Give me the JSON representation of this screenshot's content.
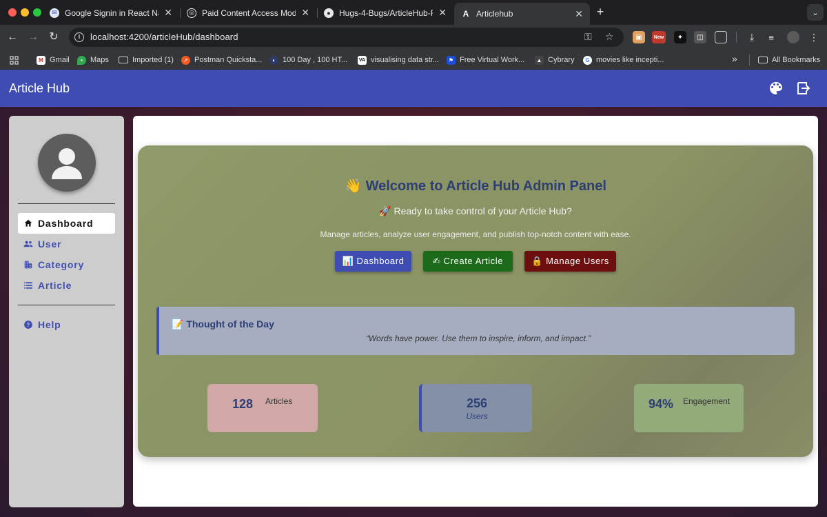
{
  "browser": {
    "tabs": [
      {
        "title": "Google Signin in React Native",
        "favicon": "app-favicon"
      },
      {
        "title": "Paid Content Access Model",
        "favicon": "openai-favicon"
      },
      {
        "title": "Hugs-4-Bugs/ArticleHub-Fro",
        "favicon": "github-favicon"
      },
      {
        "title": "Articlehub",
        "favicon": "angular-favicon",
        "active": true
      }
    ],
    "url": "localhost:4200/articleHub/dashboard",
    "extension_badge": "New",
    "bookmarks": [
      {
        "label": "Gmail",
        "icon": "gmail-icon"
      },
      {
        "label": "Maps",
        "icon": "maps-icon"
      },
      {
        "label": "Imported (1)",
        "icon": "folder-icon"
      },
      {
        "label": "Postman Quicksta...",
        "icon": "postman-icon"
      },
      {
        "label": "100 Day , 100 HT...",
        "icon": "site-icon"
      },
      {
        "label": "visualising data str...",
        "icon": "va-icon"
      },
      {
        "label": "Free Virtual Work...",
        "icon": "site-icon"
      },
      {
        "label": "Cybrary",
        "icon": "cybrary-icon"
      },
      {
        "label": "movies like incepti...",
        "icon": "google-icon"
      }
    ],
    "more_bookmarks": "»",
    "all_bookmarks": "All Bookmarks"
  },
  "app": {
    "title": "Article Hub",
    "nav": [
      {
        "label": "Dashboard",
        "icon": "home-icon",
        "active": true
      },
      {
        "label": "User",
        "icon": "people-icon"
      },
      {
        "label": "Category",
        "icon": "building-icon"
      },
      {
        "label": "Article",
        "icon": "list-icon"
      },
      {
        "label": "Help",
        "icon": "help-icon"
      }
    ],
    "hero": {
      "title": "👋 Welcome to Article Hub Admin Panel",
      "subtitle": "🚀 Ready to take control of your Article Hub?",
      "description": "Manage articles, analyze user engagement, and publish top-notch content with ease.",
      "buttons": [
        {
          "label": "📊 Dashboard",
          "color": "#3f4db3"
        },
        {
          "label": "✍ Create Article",
          "color": "#1e6a1b"
        },
        {
          "label": "🔒 Manage Users",
          "color": "#6e0f0f"
        }
      ]
    },
    "thought": {
      "title": "📝 Thought of the Day",
      "quote": "“Words have power. Use them to inspire, inform, and impact.”"
    },
    "stats": [
      {
        "value": "128",
        "label": "Articles"
      },
      {
        "value": "256",
        "label": "Users"
      },
      {
        "value": "94%",
        "label": "Engagement"
      }
    ]
  },
  "colors": {
    "brand": "#3f4db3",
    "create_button": "#1e6a1b",
    "manage_button": "#6e0f0f",
    "stat_articles": "#d0a8a8",
    "stat_users": "#8490a8",
    "stat_engagement": "#93aa7a"
  }
}
